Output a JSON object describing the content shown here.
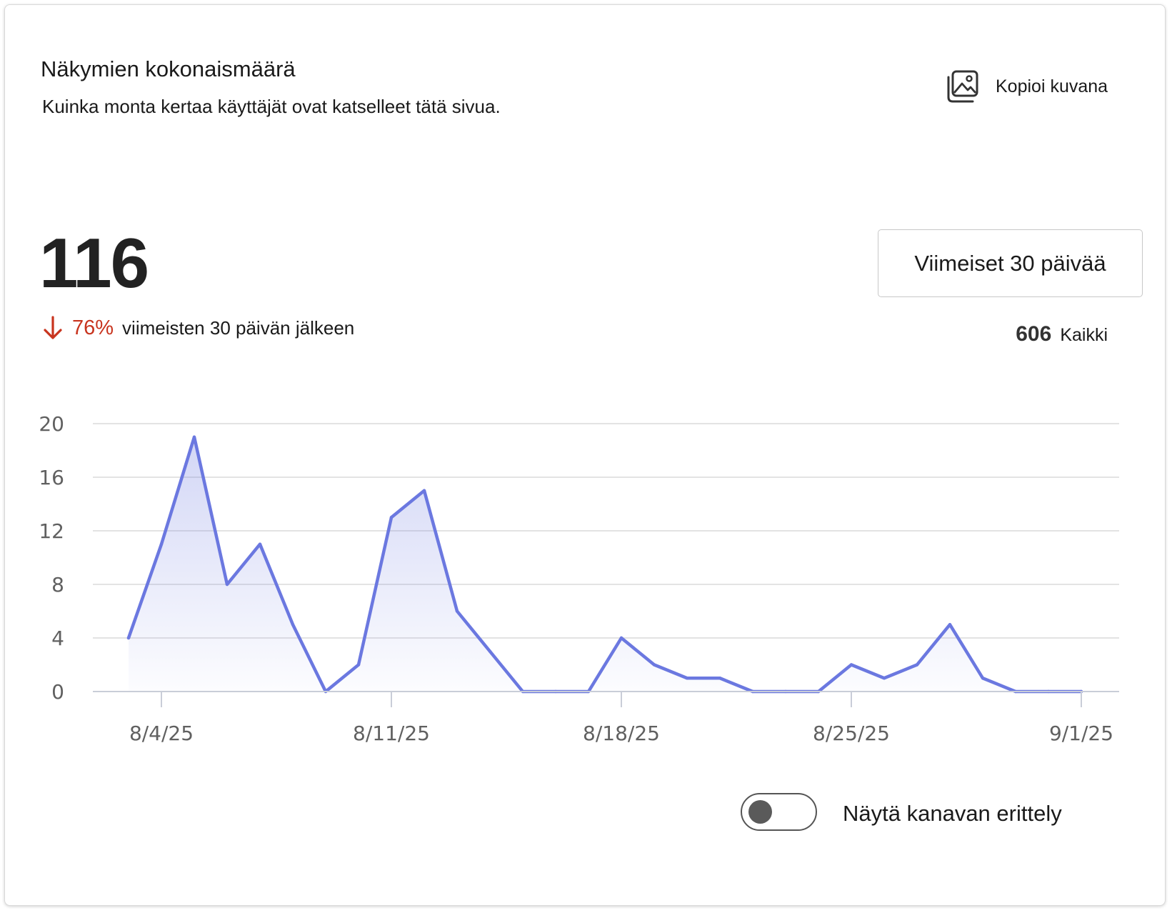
{
  "card": {
    "title": "Näkymien kokonaismäärä",
    "subtitle": "Kuinka monta kertaa käyttäjät ovat katselleet tätä sivua.",
    "copy_label": "Kopioi kuvana",
    "copy_icon": "image-copy-icon"
  },
  "summary": {
    "total": "116",
    "change_pct": "76%",
    "change_text": "viimeisten 30 päivän jälkeen",
    "change_direction": "down",
    "change_color": "#c8341e",
    "range_label": "Viimeiset 30 päivää",
    "all_count": "606",
    "all_label": "Kaikki"
  },
  "toggle": {
    "label": "Näytä kanavan erittely",
    "on": false
  },
  "chart_data": {
    "type": "area",
    "x": [
      "8/3/25",
      "8/4/25",
      "8/5/25",
      "8/6/25",
      "8/7/25",
      "8/8/25",
      "8/9/25",
      "8/10/25",
      "8/11/25",
      "8/12/25",
      "8/13/25",
      "8/14/25",
      "8/15/25",
      "8/16/25",
      "8/17/25",
      "8/18/25",
      "8/19/25",
      "8/20/25",
      "8/21/25",
      "8/22/25",
      "8/23/25",
      "8/24/25",
      "8/25/25",
      "8/26/25",
      "8/27/25",
      "8/28/25",
      "8/29/25",
      "8/30/25",
      "8/31/25",
      "9/1/25"
    ],
    "series": [
      {
        "values": [
          4,
          11,
          19,
          8,
          11,
          5,
          0,
          2,
          13,
          15,
          6,
          3,
          0,
          0,
          0,
          4,
          2,
          1,
          1,
          0,
          0,
          0,
          2,
          1,
          2,
          5,
          1,
          0,
          0,
          0
        ]
      }
    ],
    "x_tick_labels": [
      "8/4/25",
      "8/11/25",
      "8/18/25",
      "8/25/25",
      "9/1/25"
    ],
    "y_ticks": [
      0,
      4,
      8,
      12,
      16,
      20
    ],
    "ylim": [
      0,
      20
    ],
    "grid": true,
    "color": "#6b78e0"
  }
}
